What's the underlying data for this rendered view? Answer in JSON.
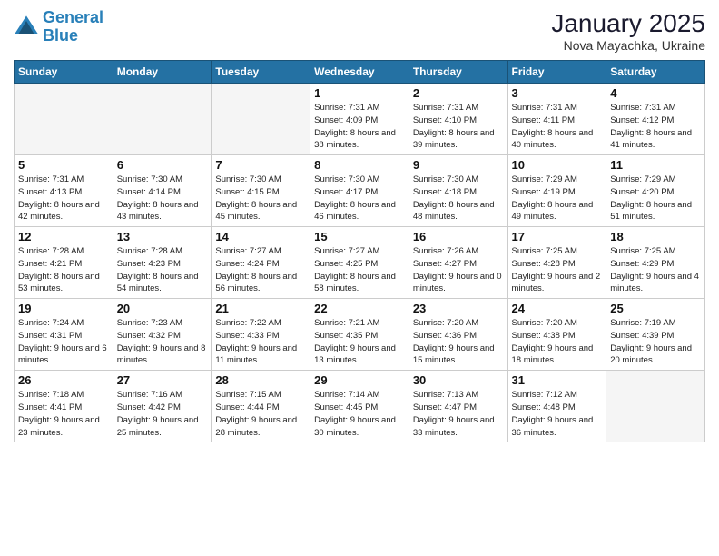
{
  "logo": {
    "line1": "General",
    "line2": "Blue"
  },
  "title": "January 2025",
  "subtitle": "Nova Mayachka, Ukraine",
  "weekdays": [
    "Sunday",
    "Monday",
    "Tuesday",
    "Wednesday",
    "Thursday",
    "Friday",
    "Saturday"
  ],
  "weeks": [
    [
      {
        "day": "",
        "info": ""
      },
      {
        "day": "",
        "info": ""
      },
      {
        "day": "",
        "info": ""
      },
      {
        "day": "1",
        "info": "Sunrise: 7:31 AM\nSunset: 4:09 PM\nDaylight: 8 hours and 38 minutes."
      },
      {
        "day": "2",
        "info": "Sunrise: 7:31 AM\nSunset: 4:10 PM\nDaylight: 8 hours and 39 minutes."
      },
      {
        "day": "3",
        "info": "Sunrise: 7:31 AM\nSunset: 4:11 PM\nDaylight: 8 hours and 40 minutes."
      },
      {
        "day": "4",
        "info": "Sunrise: 7:31 AM\nSunset: 4:12 PM\nDaylight: 8 hours and 41 minutes."
      }
    ],
    [
      {
        "day": "5",
        "info": "Sunrise: 7:31 AM\nSunset: 4:13 PM\nDaylight: 8 hours and 42 minutes."
      },
      {
        "day": "6",
        "info": "Sunrise: 7:30 AM\nSunset: 4:14 PM\nDaylight: 8 hours and 43 minutes."
      },
      {
        "day": "7",
        "info": "Sunrise: 7:30 AM\nSunset: 4:15 PM\nDaylight: 8 hours and 45 minutes."
      },
      {
        "day": "8",
        "info": "Sunrise: 7:30 AM\nSunset: 4:17 PM\nDaylight: 8 hours and 46 minutes."
      },
      {
        "day": "9",
        "info": "Sunrise: 7:30 AM\nSunset: 4:18 PM\nDaylight: 8 hours and 48 minutes."
      },
      {
        "day": "10",
        "info": "Sunrise: 7:29 AM\nSunset: 4:19 PM\nDaylight: 8 hours and 49 minutes."
      },
      {
        "day": "11",
        "info": "Sunrise: 7:29 AM\nSunset: 4:20 PM\nDaylight: 8 hours and 51 minutes."
      }
    ],
    [
      {
        "day": "12",
        "info": "Sunrise: 7:28 AM\nSunset: 4:21 PM\nDaylight: 8 hours and 53 minutes."
      },
      {
        "day": "13",
        "info": "Sunrise: 7:28 AM\nSunset: 4:23 PM\nDaylight: 8 hours and 54 minutes."
      },
      {
        "day": "14",
        "info": "Sunrise: 7:27 AM\nSunset: 4:24 PM\nDaylight: 8 hours and 56 minutes."
      },
      {
        "day": "15",
        "info": "Sunrise: 7:27 AM\nSunset: 4:25 PM\nDaylight: 8 hours and 58 minutes."
      },
      {
        "day": "16",
        "info": "Sunrise: 7:26 AM\nSunset: 4:27 PM\nDaylight: 9 hours and 0 minutes."
      },
      {
        "day": "17",
        "info": "Sunrise: 7:25 AM\nSunset: 4:28 PM\nDaylight: 9 hours and 2 minutes."
      },
      {
        "day": "18",
        "info": "Sunrise: 7:25 AM\nSunset: 4:29 PM\nDaylight: 9 hours and 4 minutes."
      }
    ],
    [
      {
        "day": "19",
        "info": "Sunrise: 7:24 AM\nSunset: 4:31 PM\nDaylight: 9 hours and 6 minutes."
      },
      {
        "day": "20",
        "info": "Sunrise: 7:23 AM\nSunset: 4:32 PM\nDaylight: 9 hours and 8 minutes."
      },
      {
        "day": "21",
        "info": "Sunrise: 7:22 AM\nSunset: 4:33 PM\nDaylight: 9 hours and 11 minutes."
      },
      {
        "day": "22",
        "info": "Sunrise: 7:21 AM\nSunset: 4:35 PM\nDaylight: 9 hours and 13 minutes."
      },
      {
        "day": "23",
        "info": "Sunrise: 7:20 AM\nSunset: 4:36 PM\nDaylight: 9 hours and 15 minutes."
      },
      {
        "day": "24",
        "info": "Sunrise: 7:20 AM\nSunset: 4:38 PM\nDaylight: 9 hours and 18 minutes."
      },
      {
        "day": "25",
        "info": "Sunrise: 7:19 AM\nSunset: 4:39 PM\nDaylight: 9 hours and 20 minutes."
      }
    ],
    [
      {
        "day": "26",
        "info": "Sunrise: 7:18 AM\nSunset: 4:41 PM\nDaylight: 9 hours and 23 minutes."
      },
      {
        "day": "27",
        "info": "Sunrise: 7:16 AM\nSunset: 4:42 PM\nDaylight: 9 hours and 25 minutes."
      },
      {
        "day": "28",
        "info": "Sunrise: 7:15 AM\nSunset: 4:44 PM\nDaylight: 9 hours and 28 minutes."
      },
      {
        "day": "29",
        "info": "Sunrise: 7:14 AM\nSunset: 4:45 PM\nDaylight: 9 hours and 30 minutes."
      },
      {
        "day": "30",
        "info": "Sunrise: 7:13 AM\nSunset: 4:47 PM\nDaylight: 9 hours and 33 minutes."
      },
      {
        "day": "31",
        "info": "Sunrise: 7:12 AM\nSunset: 4:48 PM\nDaylight: 9 hours and 36 minutes."
      },
      {
        "day": "",
        "info": ""
      }
    ]
  ]
}
